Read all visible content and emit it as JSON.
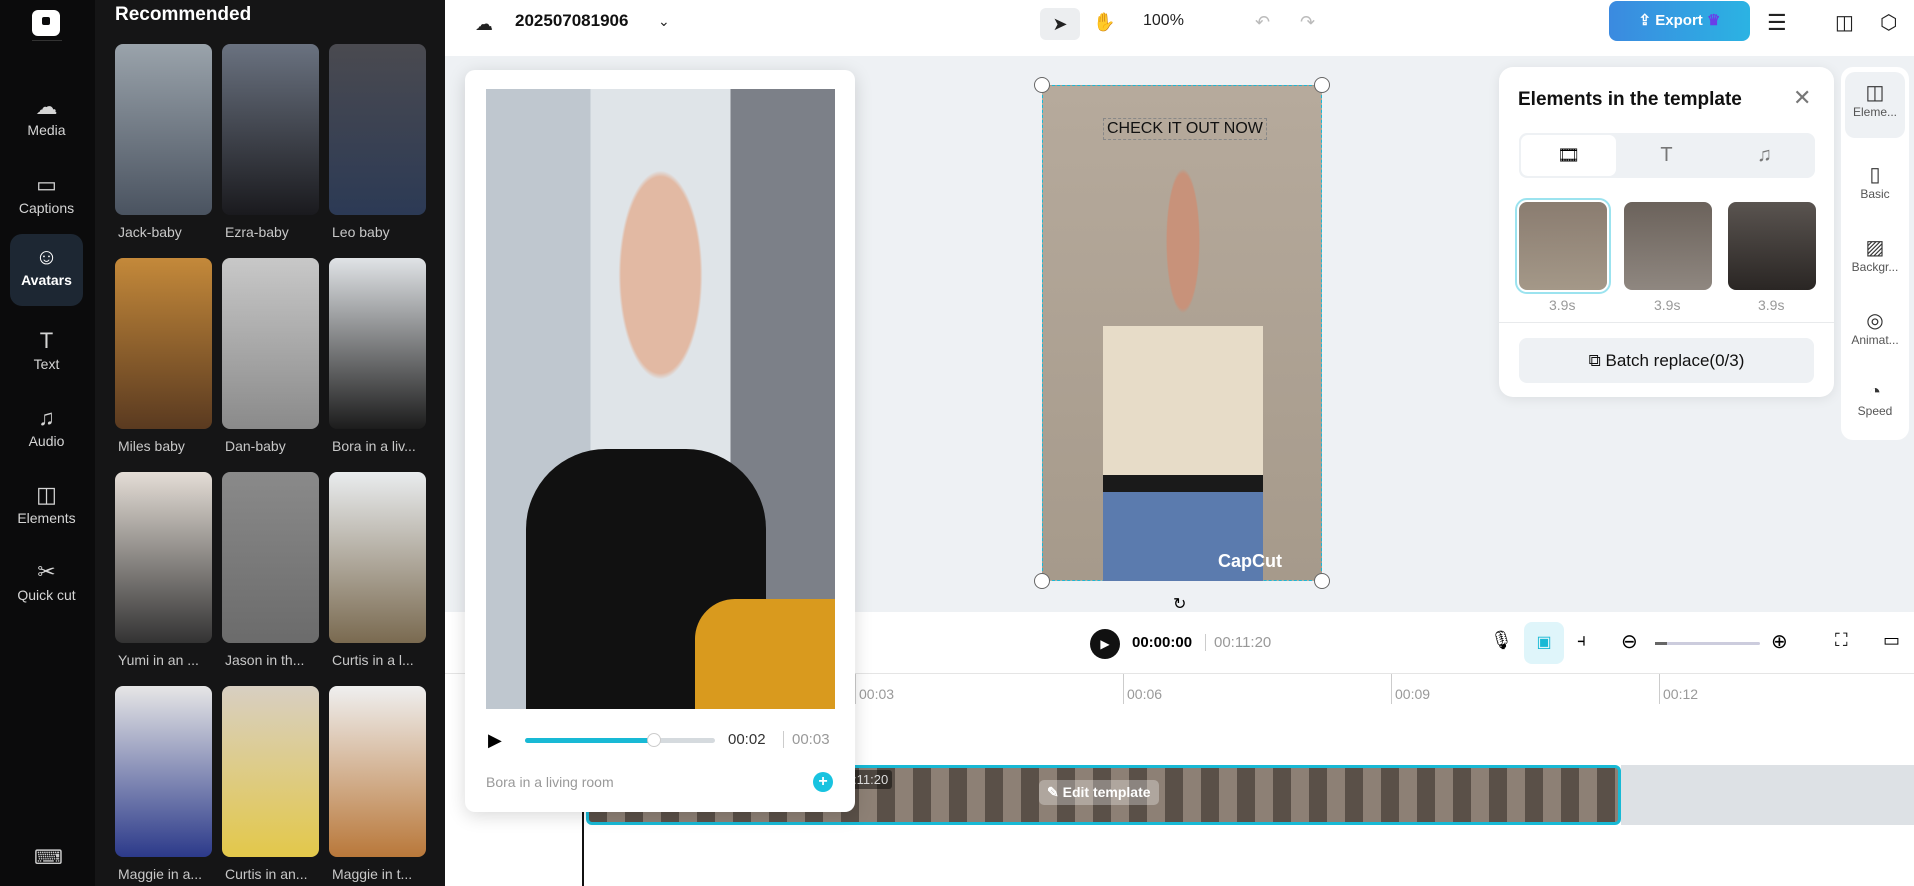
{
  "nav": {
    "items": [
      {
        "label": "Media",
        "icon": "cloud-upload-icon"
      },
      {
        "label": "Captions",
        "icon": "captions-icon"
      },
      {
        "label": "Avatars",
        "icon": "avatar-icon"
      },
      {
        "label": "Text",
        "icon": "text-icon"
      },
      {
        "label": "Audio",
        "icon": "music-icon"
      },
      {
        "label": "Elements",
        "icon": "elements-icon"
      },
      {
        "label": "Quick cut",
        "icon": "scissors-icon"
      }
    ]
  },
  "panel": {
    "heading": "Recommended",
    "avatars": [
      "Jack-baby",
      "Ezra-baby",
      "Leo baby",
      "Miles baby",
      "Dan-baby",
      "Bora in a liv...",
      "Yumi in an ...",
      "Jason in th...",
      "Curtis in a l...",
      "Maggie in a...",
      "Curtis in an...",
      "Maggie in t..."
    ]
  },
  "topbar": {
    "title": "202507081906",
    "zoom": "100%",
    "export": "Export"
  },
  "canvas": {
    "text": "CHECK IT OUT NOW",
    "watermark": "CapCut"
  },
  "preview": {
    "current": "00:02",
    "total": "00:03",
    "progress": 0.68,
    "name": "Bora in a living room"
  },
  "elements": {
    "title": "Elements in the template",
    "durations": [
      "3.9s",
      "3.9s",
      "3.9s"
    ],
    "batch": "Batch replace(0/3)"
  },
  "rail": [
    {
      "label": "Eleme..."
    },
    {
      "label": "Basic"
    },
    {
      "label": "Backgr..."
    },
    {
      "label": "Animat..."
    },
    {
      "label": "Speed"
    }
  ],
  "playback": {
    "current": "00:00:00",
    "total": "00:11:20"
  },
  "timeline": {
    "ticks": [
      "00:03",
      "00:06",
      "00:09",
      "00:12"
    ],
    "clip_time": ":11:20",
    "edit": "Edit template"
  },
  "colors": {
    "accent": "#18b9d5"
  }
}
